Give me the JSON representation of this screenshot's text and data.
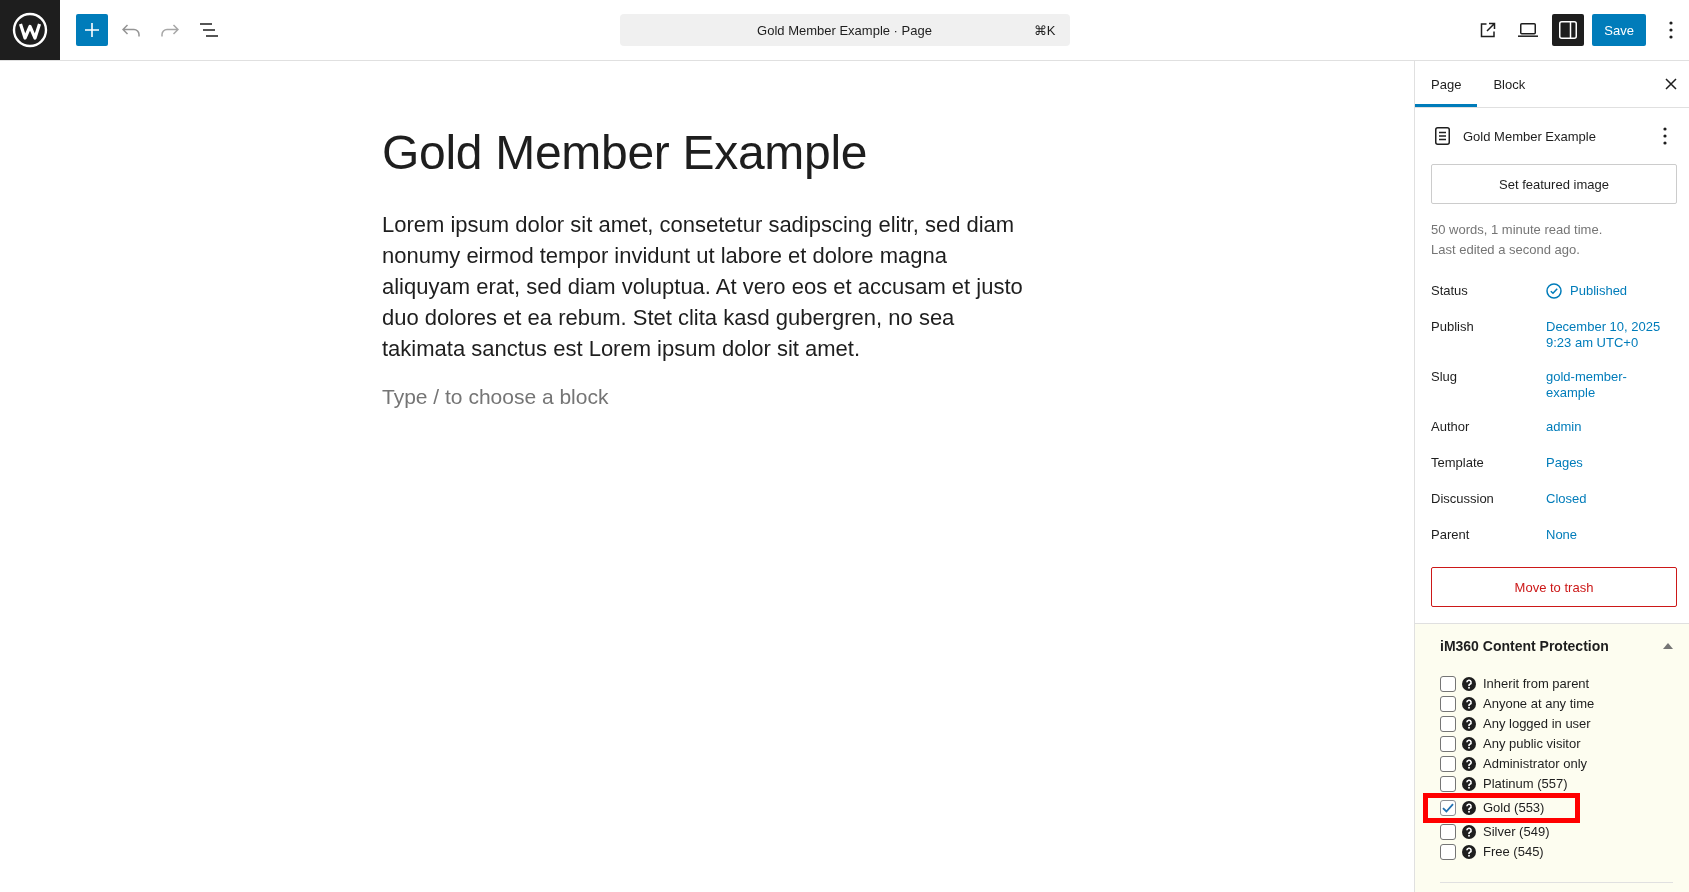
{
  "toolbar": {
    "command_bar": {
      "title": "Gold Member Example · Page",
      "shortcut": "⌘K"
    },
    "settings_toggle": {
      "pressed": true
    },
    "save_button": "Save"
  },
  "editor": {
    "title": "Gold Member Example",
    "paragraph": "Lorem ipsum dolor sit amet, consetetur sadipscing elitr, sed diam nonumy eirmod tempor invidunt ut labore et dolore magna aliquyam erat, sed diam voluptua. At vero eos et accusam et justo duo dolores et ea rebum. Stet clita kasd gubergren, no sea takimata sanctus est Lorem ipsum dolor sit amet.",
    "placeholder": "Type / to choose a block"
  },
  "sidebar": {
    "tabs": [
      {
        "label": "Page",
        "selected": true
      },
      {
        "label": "Block",
        "selected": false
      }
    ],
    "summary": {
      "title": "Gold Member Example",
      "featured_image_button": "Set featured image",
      "stats": "50 words, 1 minute read time.",
      "last_edited": "Last edited a second ago."
    },
    "fields": [
      {
        "label": "Status",
        "value": "Published",
        "kind": "status"
      },
      {
        "label": "Publish",
        "value": "December 10, 2025 9:23 am UTC+0",
        "kind": "link"
      },
      {
        "label": "Slug",
        "value": "gold-member-example",
        "kind": "link"
      },
      {
        "label": "Author",
        "value": "admin",
        "kind": "link"
      },
      {
        "label": "Template",
        "value": "Pages",
        "kind": "link"
      },
      {
        "label": "Discussion",
        "value": "Closed",
        "kind": "link"
      },
      {
        "label": "Parent",
        "value": "None",
        "kind": "link"
      }
    ],
    "trash_button": "Move to trash",
    "protection": {
      "title": "iM360 Content Protection",
      "expanded": true,
      "options": [
        {
          "label": "Inherit from parent",
          "checked": false,
          "highlighted": false
        },
        {
          "label": "Anyone at any time",
          "checked": false,
          "highlighted": false
        },
        {
          "label": "Any logged in user",
          "checked": false,
          "highlighted": false
        },
        {
          "label": "Any public visitor",
          "checked": false,
          "highlighted": false
        },
        {
          "label": "Administrator only",
          "checked": false,
          "highlighted": false
        },
        {
          "label": "Platinum (557)",
          "checked": false,
          "highlighted": false
        },
        {
          "label": "Gold (553)",
          "checked": true,
          "highlighted": true
        },
        {
          "label": "Silver (549)",
          "checked": false,
          "highlighted": false
        },
        {
          "label": "Free (545)",
          "checked": false,
          "highlighted": false
        }
      ]
    }
  }
}
